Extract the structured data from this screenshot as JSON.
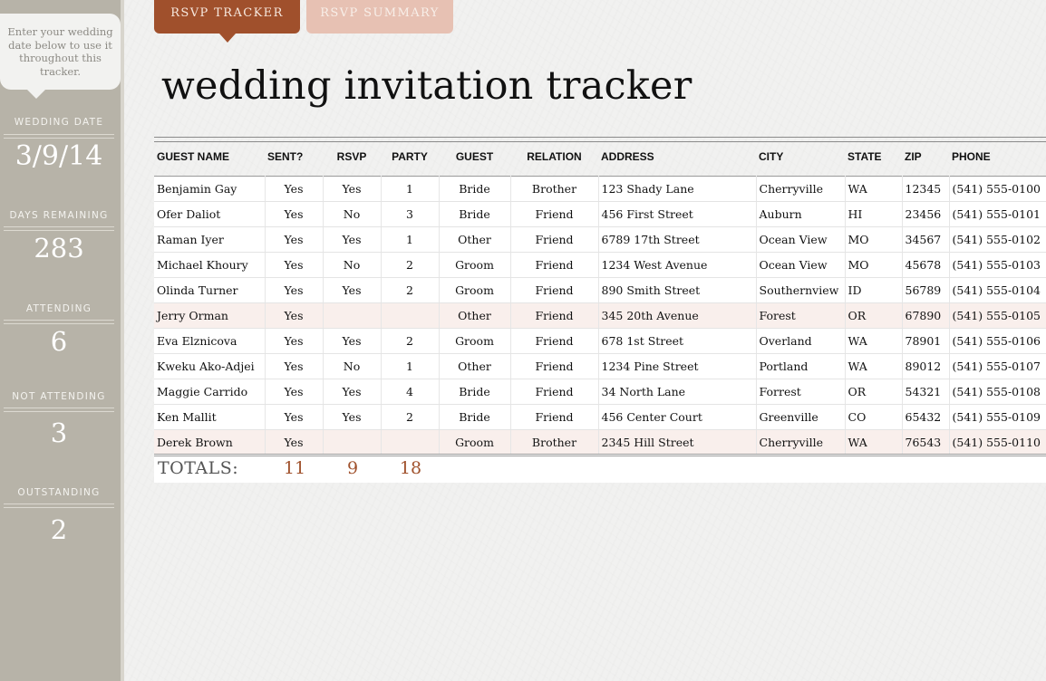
{
  "sidebar": {
    "tip": "Enter your wedding date below to use it throughout this tracker.",
    "stats": [
      {
        "label": "WEDDING DATE",
        "value": "3/9/14"
      },
      {
        "label": "DAYS REMAINING",
        "value": "283"
      },
      {
        "label": "ATTENDING",
        "value": "6"
      },
      {
        "label": "NOT ATTENDING",
        "value": "3"
      },
      {
        "label": "OUTSTANDING",
        "value": "2"
      }
    ]
  },
  "tabs": [
    {
      "label": "RSVP TRACKER",
      "active": true
    },
    {
      "label": "RSVP SUMMARY",
      "active": false
    }
  ],
  "title": "wedding invitation tracker",
  "table": {
    "columns": [
      "GUEST NAME",
      "SENT?",
      "RSVP",
      "PARTY",
      "GUEST",
      "RELATION",
      "ADDRESS",
      "CITY",
      "STATE",
      "ZIP",
      "PHONE"
    ],
    "rows": [
      [
        "Benjamin Gay",
        "Yes",
        "Yes",
        "1",
        "Bride",
        "Brother",
        "123 Shady Lane",
        "Cherryville",
        "WA",
        "12345",
        "(541) 555-0100"
      ],
      [
        "Ofer Daliot",
        "Yes",
        "No",
        "3",
        "Bride",
        "Friend",
        "456 First Street",
        "Auburn",
        "HI",
        "23456",
        "(541) 555-0101"
      ],
      [
        "Raman Iyer",
        "Yes",
        "Yes",
        "1",
        "Other",
        "Friend",
        "6789 17th Street",
        "Ocean View",
        "MO",
        "34567",
        "(541) 555-0102"
      ],
      [
        "Michael Khoury",
        "Yes",
        "No",
        "2",
        "Groom",
        "Friend",
        "1234 West Avenue",
        "Ocean View",
        "MO",
        "45678",
        "(541) 555-0103"
      ],
      [
        "Olinda Turner",
        "Yes",
        "Yes",
        "2",
        "Groom",
        "Friend",
        "890 Smith Street",
        "Southernview",
        "ID",
        "56789",
        "(541) 555-0104"
      ],
      [
        "Jerry Orman",
        "Yes",
        "",
        "",
        "Other",
        "Friend",
        "345 20th Avenue",
        "Forest",
        "OR",
        "67890",
        "(541) 555-0105"
      ],
      [
        "Eva Elznicova",
        "Yes",
        "Yes",
        "2",
        "Groom",
        "Friend",
        "678 1st Street",
        "Overland",
        "WA",
        "78901",
        "(541) 555-0106"
      ],
      [
        "Kweku Ako-Adjei",
        "Yes",
        "No",
        "1",
        "Other",
        "Friend",
        "1234 Pine Street",
        "Portland",
        "WA",
        "89012",
        "(541) 555-0107"
      ],
      [
        "Maggie Carrido",
        "Yes",
        "Yes",
        "4",
        "Bride",
        "Friend",
        "34 North Lane",
        "Forrest",
        "OR",
        "54321",
        "(541) 555-0108"
      ],
      [
        "Ken Mallit",
        "Yes",
        "Yes",
        "2",
        "Bride",
        "Friend",
        "456 Center Court",
        "Greenville",
        "CO",
        "65432",
        "(541) 555-0109"
      ],
      [
        "Derek Brown",
        "Yes",
        "",
        "",
        "Groom",
        "Brother",
        "2345 Hill Street",
        "Cherryville",
        "WA",
        "76543",
        "(541) 555-0110"
      ]
    ],
    "totals": {
      "label": "TOTALS:",
      "sent": "11",
      "rsvp": "9",
      "party": "18"
    }
  },
  "colors": {
    "sidebar": "#b7b3a8",
    "accent": "#a0502c",
    "tab_inactive": "#e7c1b3",
    "pending_row": "#f9efec"
  }
}
